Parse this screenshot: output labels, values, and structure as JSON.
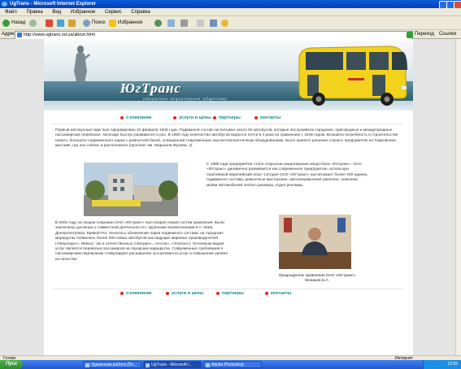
{
  "window": {
    "title": "UgTrans - Microsoft Internet Explorer"
  },
  "menu": [
    "Файл",
    "Правка",
    "Вид",
    "Избранное",
    "Сервис",
    "Справка"
  ],
  "toolbar": {
    "back": "Назад",
    "search": "Поиск",
    "favorites": "Избранное"
  },
  "address": {
    "label": "Адрес:",
    "url": "http://www.ugtrans.od.ua/about.html",
    "go": "Переход",
    "links": "Ссылки"
  },
  "banner": {
    "logo": "ЮгТранс",
    "subtitle": "открытое акционерное общество"
  },
  "nav": [
    "о компании",
    "услуги и цены",
    "партнеры",
    "контакты"
  ],
  "content": {
    "para1": "Первый автобусный парк был сформирован 22 февраля 1946 года. Подвижной состав насчитывал около 50 автобусов, которые обслуживали городские, пригородные и междугородные пассажирские перевозки. Автопарк быстро развивался и рос. В 1960 году количество автобусов выросло почти в 4 раза по сравнению с 1946 годом. Возникла потребность в строительстве нового, большого современного парка с ремонтной базой, оснащенной современным, высокотехнологичным оборудованием. Было принято решение строить предприятие на Таировском массиве, где оно сейчас и расположено (проспект им. Маршала Жукова, 2).",
    "para2": "С 1995 года предприятие стало открытым акционерным обществом «Югтранс». ОАО «Югтранс» динамично развивается как современное предприятие, использую позитивный европейский опыт. Сегодня ОАО «Югтранс» насчитывает более 400 единиц подвижного состава, ремонтные мастерские, автозаправочный комплекс, комплекс мойки автомобилей любого размера, отдел рекламы.",
    "para3": "В 2004 году на общем собрании ОАО «Югтранс» был избран новый состав правления. Были заключены договора о совместной деятельности с крупными перевозчиками в гг. Киев, Днепропетровск, Кривой Рог. Началось обновление парка подвижного состава: на городских маршрутах появились более 200 новых автобусов как ведущих мировых производителей («Мерседес», Ивеко), так и отечественных («Богдан», «Антон», «Эталон»). Основным видом услуг является перевозка пассажиров на городских маршрутах. Современные требования к пассажирским перевозкам стимулируют расширение ассортимента услуг и повышение уровня их качества.",
    "caption_line1": "Председатель правления ОАО «Югтранс»",
    "caption_line2": "Монахов Б.А."
  },
  "status": {
    "text": "Готово",
    "zone": "Интернет"
  },
  "taskbar": {
    "start": "Пуск",
    "tasks": [
      "Удаленная работа (По...",
      "UgTrans - Microsoft I...",
      "Adobe Photoshop"
    ],
    "clock": "12:55"
  }
}
